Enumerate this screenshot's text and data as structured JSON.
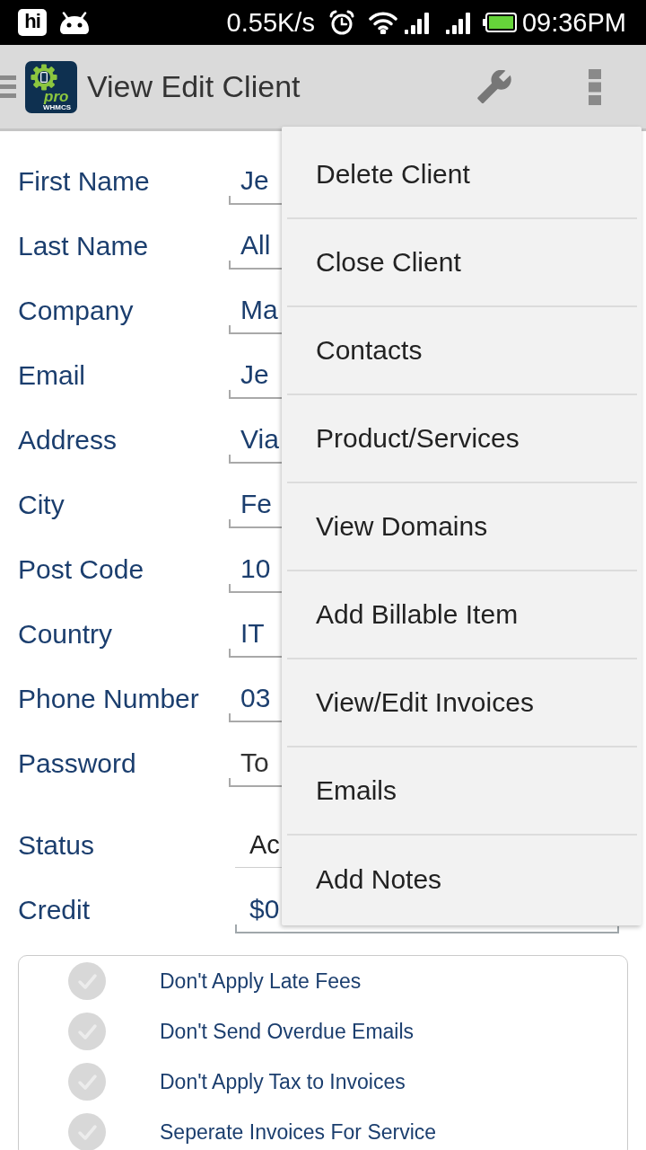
{
  "status_bar": {
    "app_badge": "hi",
    "network_speed": "0.55K/s",
    "time": "09:36PM"
  },
  "app_bar": {
    "logo": {
      "wordmark": "pro",
      "caption": "WHMCS"
    },
    "title": "View Edit Client"
  },
  "overflow_menu": {
    "items": [
      "Delete Client",
      "Close Client",
      "Contacts",
      "Product/Services",
      "View Domains",
      "Add Billable Item",
      "View/Edit Invoices",
      "Emails",
      "Add Notes"
    ]
  },
  "form": {
    "rows": [
      {
        "label": "First Name",
        "kind": "text",
        "value": "Je"
      },
      {
        "label": "Last Name",
        "kind": "text",
        "value": "All"
      },
      {
        "label": "Company",
        "kind": "text",
        "value": "Ma"
      },
      {
        "label": "Email",
        "kind": "text",
        "value": "Je"
      },
      {
        "label": "Address",
        "kind": "text",
        "value": "Via"
      },
      {
        "label": "City",
        "kind": "text",
        "value": "Fe"
      },
      {
        "label": "Post Code",
        "kind": "text",
        "value": "10"
      },
      {
        "label": "Country",
        "kind": "text",
        "value": "IT"
      },
      {
        "label": "Phone Number",
        "kind": "text",
        "value": "03"
      },
      {
        "label": "Password",
        "kind": "text",
        "placeholder": "To"
      },
      {
        "label": "Status",
        "kind": "select",
        "value": "Ac"
      },
      {
        "label": "Credit",
        "kind": "amount",
        "value": "$0"
      }
    ]
  },
  "options": [
    {
      "label": "Don't Apply Late Fees",
      "checked": false
    },
    {
      "label": "Don't Send Overdue Emails",
      "checked": false
    },
    {
      "label": "Don't Apply Tax to Invoices",
      "checked": false
    },
    {
      "label": "Seperate Invoices For Service",
      "checked": false
    }
  ]
}
